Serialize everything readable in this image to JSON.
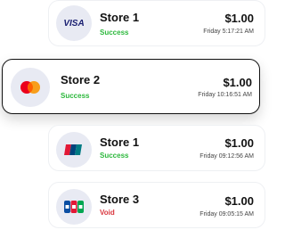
{
  "colors": {
    "success": "#2db83d",
    "void": "#d9363e",
    "selected_border": "#111111",
    "logo_bg": "#e8eaf3"
  },
  "transactions": [
    {
      "store": "Store 1",
      "status": "Success",
      "status_type": "success",
      "amount": "$1.00",
      "time": "Friday 5:17:21 AM",
      "card_icon": "visa-icon",
      "card_logo_text": "VISA"
    },
    {
      "store": "Store 2",
      "status": "Success",
      "status_type": "success",
      "amount": "$1.00",
      "time": "Friday 10:16:51 AM",
      "card_icon": "mastercard-icon",
      "selected": true
    },
    {
      "store": "Store 1",
      "status": "Success",
      "status_type": "success",
      "amount": "$1.00",
      "time": "Friday 09:12:56 AM",
      "card_icon": "unionpay-icon"
    },
    {
      "store": "Store 3",
      "status": "Void",
      "status_type": "void",
      "amount": "$1.00",
      "time": "Friday 09:05:15 AM",
      "card_icon": "jcb-icon"
    }
  ]
}
